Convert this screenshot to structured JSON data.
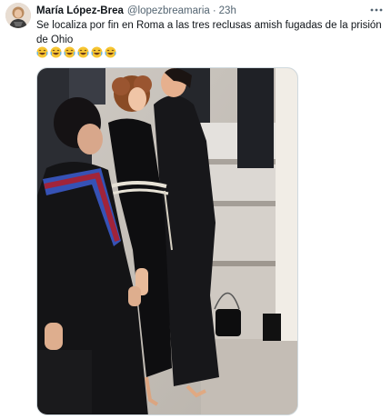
{
  "author": {
    "name": "María López-Brea",
    "handle": "@lopezbreamaria",
    "separator": "·",
    "time": "23h"
  },
  "tweet": {
    "text": "Se localiza por fin en Roma a las tres reclusas amish fugadas de la prisión de Ohio",
    "emojis": [
      "😂",
      "😂",
      "😂",
      "😂",
      "😂",
      "😂"
    ]
  },
  "icons": {
    "more": "more-horizontal-icon",
    "avatar": "profile-avatar"
  },
  "colors": {
    "text": "#0f1419",
    "secondary": "#536471",
    "border": "#cfd9de"
  }
}
